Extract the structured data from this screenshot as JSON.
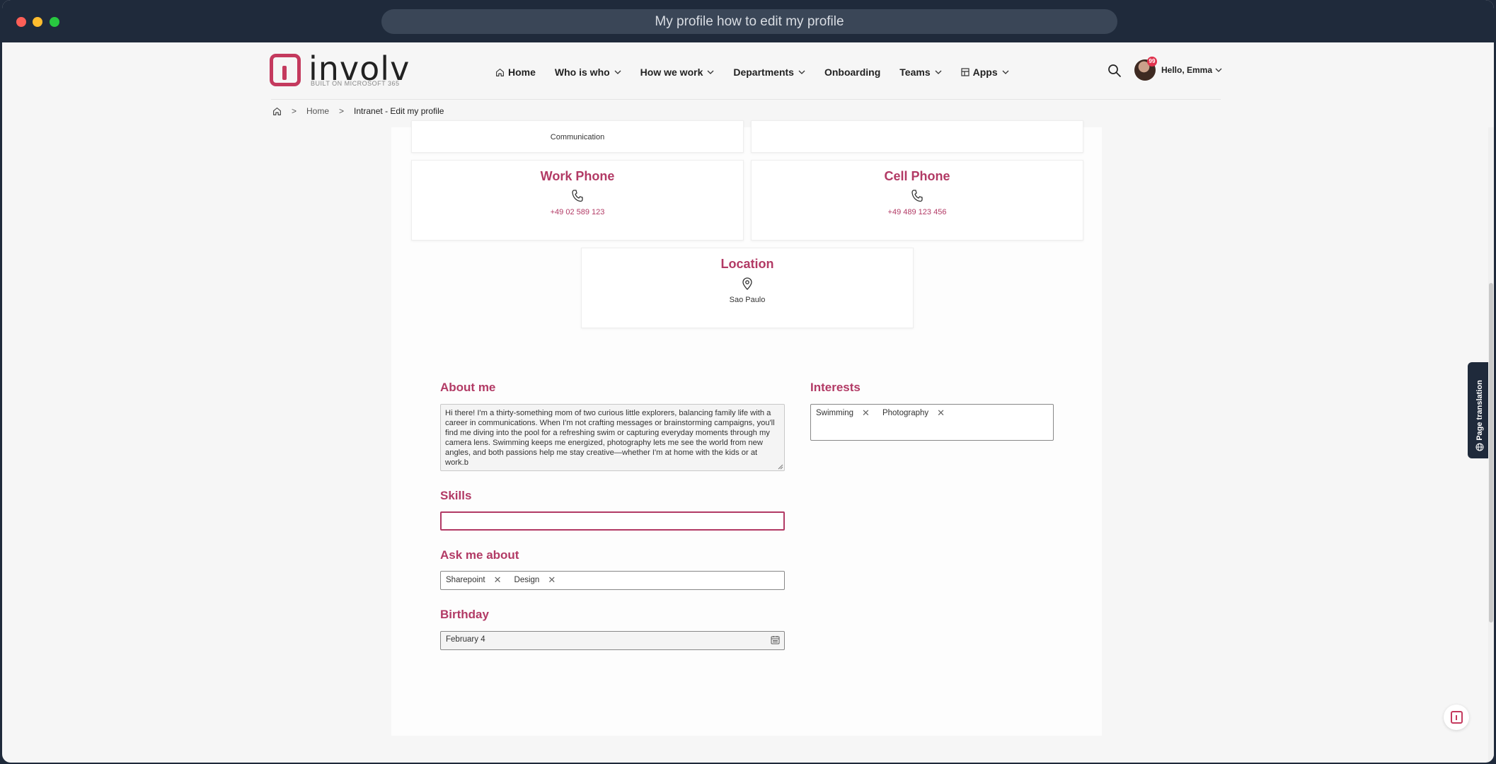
{
  "window": {
    "url_title": "My profile how to edit my profile"
  },
  "brand": {
    "name": "involv",
    "tagline": "BUILT ON MICROSOFT 365"
  },
  "nav": {
    "home": "Home",
    "who_is_who": "Who is who",
    "how_we_work": "How we work",
    "departments": "Departments",
    "onboarding": "Onboarding",
    "teams": "Teams",
    "apps": "Apps"
  },
  "user": {
    "greeting": "Hello, Emma",
    "notifications": "99"
  },
  "breadcrumb": {
    "sep": ">",
    "home": "Home",
    "current": "Intranet - Edit my profile"
  },
  "profile": {
    "partial_value": "Communication",
    "work_phone": {
      "label": "Work Phone",
      "value": "+49 02 589 123"
    },
    "cell_phone": {
      "label": "Cell Phone",
      "value": "+49 489 123 456"
    },
    "location": {
      "label": "Location",
      "value": "Sao Paulo"
    }
  },
  "about": {
    "label": "About me",
    "text": "Hi there! I'm a thirty-something mom of two curious little explorers, balancing family life with a career in communications. When I'm not crafting messages or brainstorming campaigns, you'll find me diving into the pool for a refreshing swim or capturing everyday moments through my camera lens. Swimming keeps me energized, photography lets me see the world from new angles, and both passions help me stay creative—whether I'm at home with the kids or at work.b"
  },
  "interests": {
    "label": "Interests",
    "tags": [
      "Swimming",
      "Photography"
    ]
  },
  "skills": {
    "label": "Skills",
    "value": ""
  },
  "ask_me_about": {
    "label": "Ask me about",
    "tags": [
      "Sharepoint",
      "Design"
    ]
  },
  "birthday": {
    "label": "Birthday",
    "value": "February 4"
  },
  "side_tab": {
    "label": "Page translation"
  },
  "colors": {
    "accent": "#b23a65",
    "chrome": "#1f2a3b"
  }
}
